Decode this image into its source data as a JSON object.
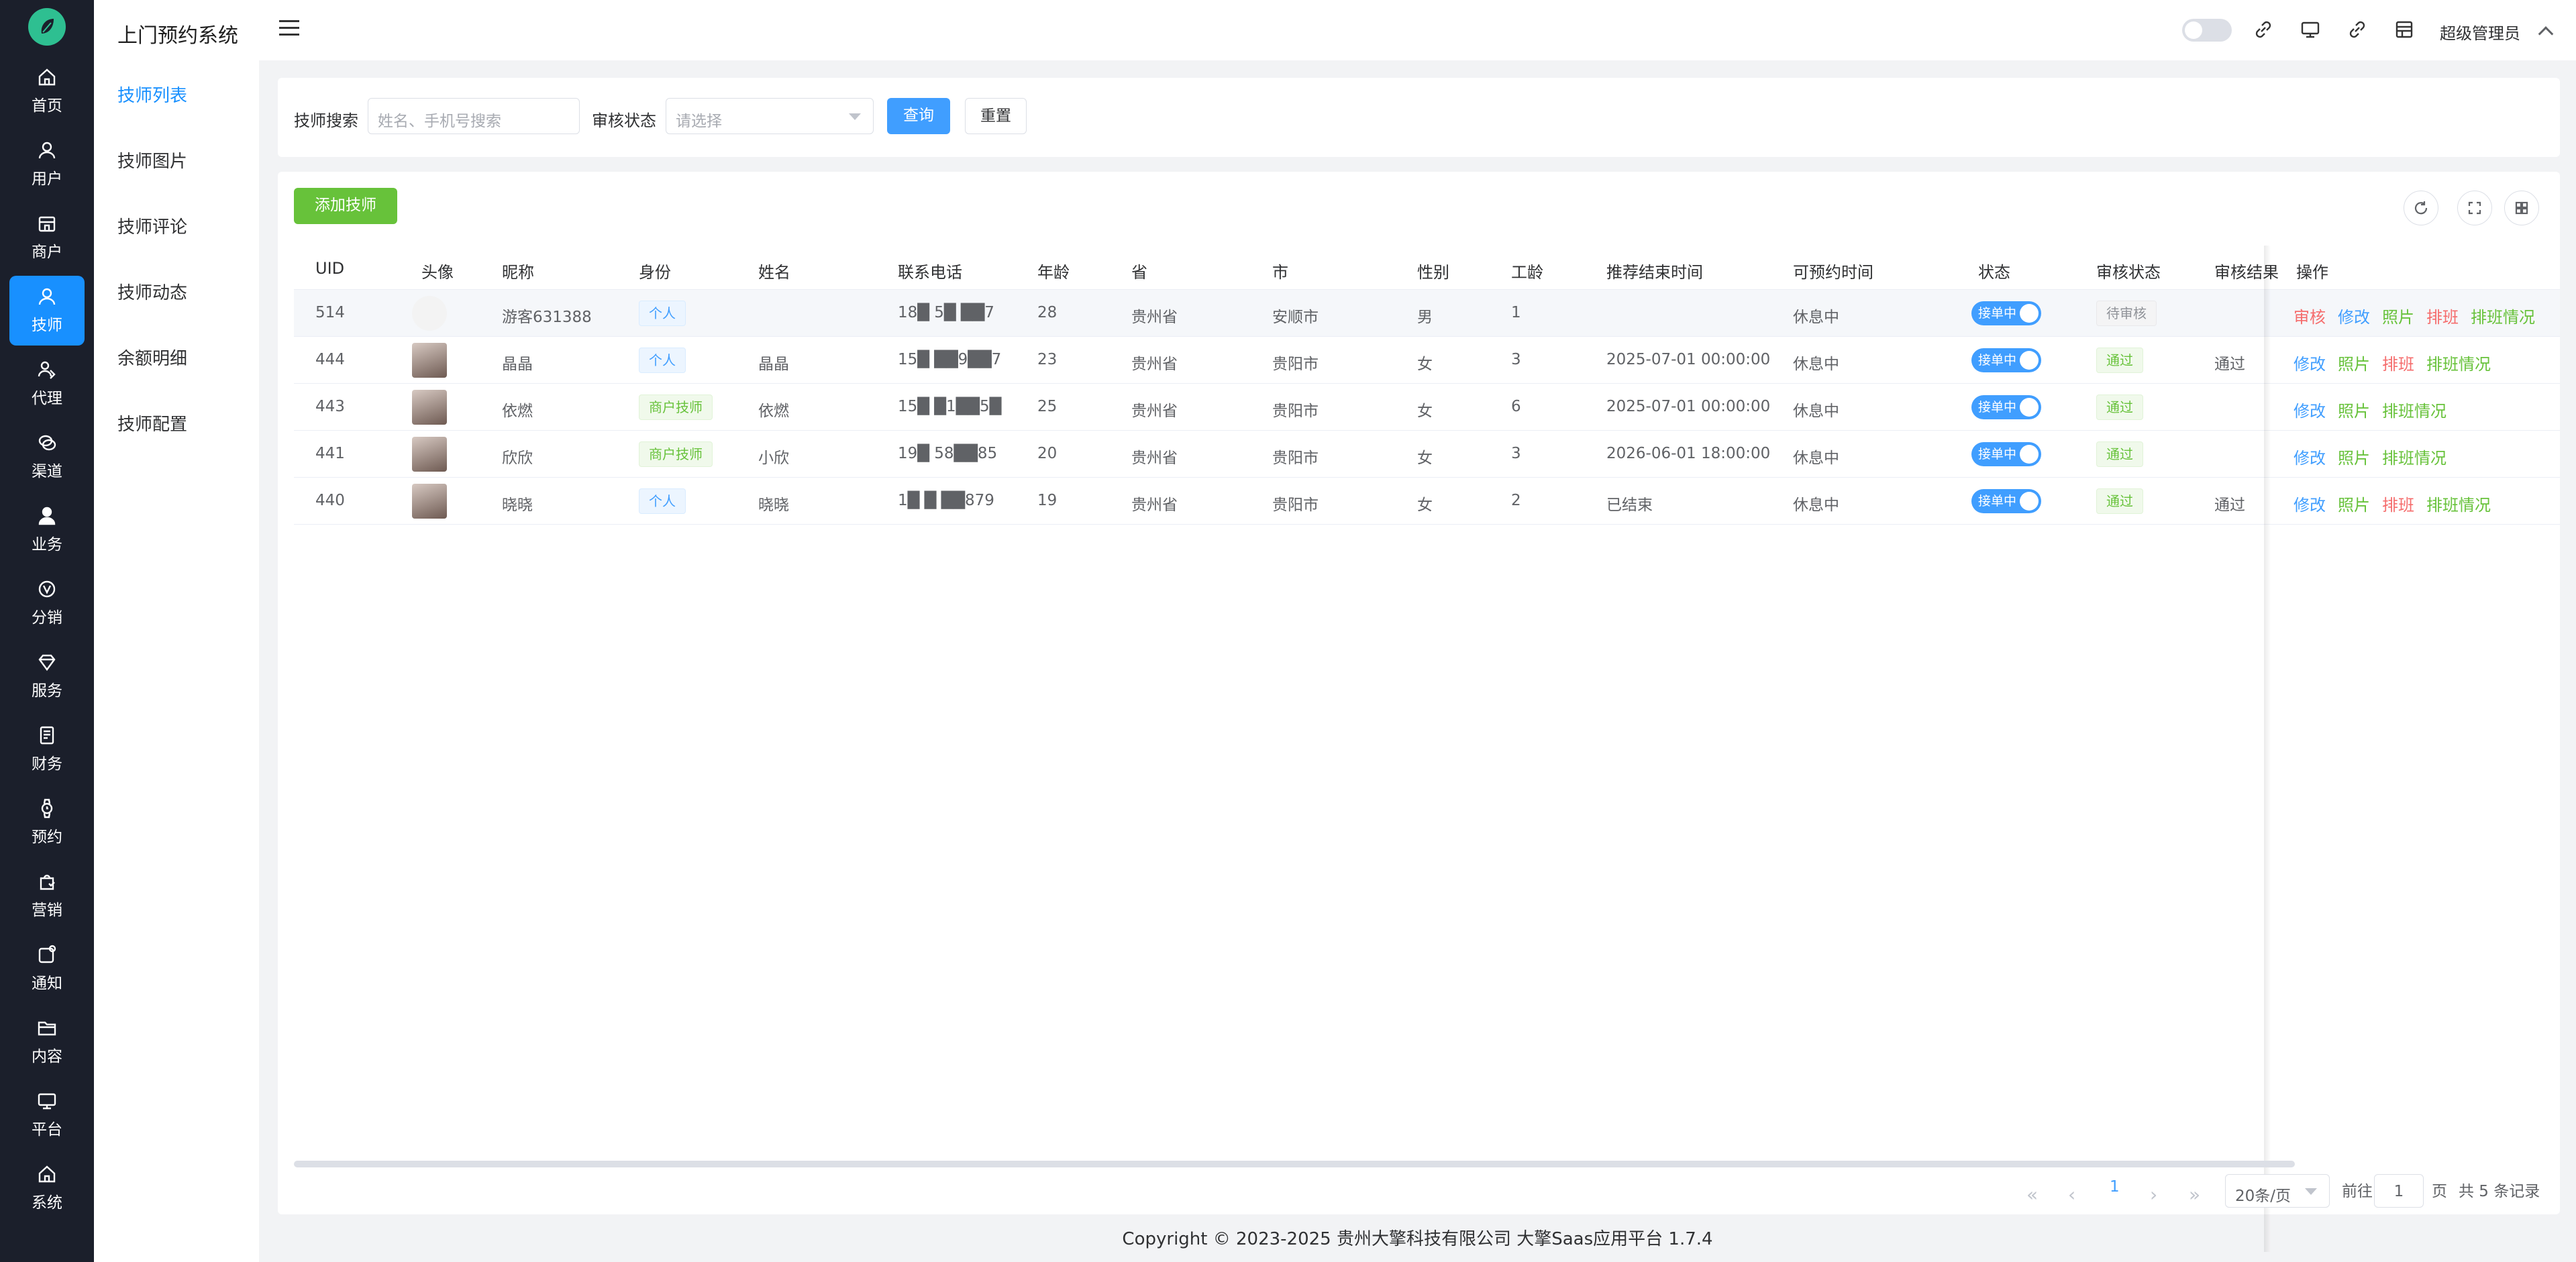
{
  "rail": {
    "items": [
      {
        "label": "首页",
        "icon": "home-icon"
      },
      {
        "label": "用户",
        "icon": "user-icon"
      },
      {
        "label": "商户",
        "icon": "store-icon"
      },
      {
        "label": "技师",
        "icon": "technician-icon"
      },
      {
        "label": "代理",
        "icon": "agent-icon"
      },
      {
        "label": "渠道",
        "icon": "channel-icon"
      },
      {
        "label": "业务",
        "icon": "business-icon"
      },
      {
        "label": "分销",
        "icon": "distribution-icon"
      },
      {
        "label": "服务",
        "icon": "diamond-icon"
      },
      {
        "label": "财务",
        "icon": "finance-icon"
      },
      {
        "label": "预约",
        "icon": "watch-icon"
      },
      {
        "label": "营销",
        "icon": "marketing-icon"
      },
      {
        "label": "通知",
        "icon": "notify-icon"
      },
      {
        "label": "内容",
        "icon": "folder-icon"
      },
      {
        "label": "平台",
        "icon": "monitor-icon"
      },
      {
        "label": "系统",
        "icon": "system-home-icon"
      }
    ],
    "active_index": 3
  },
  "submenu": {
    "title": "上门预约系统",
    "items": [
      "技师列表",
      "技师图片",
      "技师评论",
      "技师动态",
      "余额明细",
      "技师配置"
    ],
    "active_index": 0
  },
  "topbar": {
    "admin_label": "超级管理员",
    "icons": [
      "menu-icon",
      "theme-toggle",
      "link-icon",
      "monitor-icon",
      "link-icon",
      "store-icon"
    ]
  },
  "search": {
    "search_label": "技师搜索",
    "search_placeholder": "姓名、手机号搜索",
    "status_label": "审核状态",
    "status_placeholder": "请选择",
    "query_button": "查询",
    "reset_button": "重置"
  },
  "table": {
    "add_button": "添加技师",
    "columns": [
      "UID",
      "头像",
      "昵称",
      "身份",
      "姓名",
      "联系电话",
      "年龄",
      "省",
      "市",
      "性别",
      "工龄",
      "推荐结束时间",
      "可预约时间",
      "状态",
      "审核状态",
      "审核结果",
      "操作"
    ],
    "rows": [
      {
        "uid": "514",
        "avatar": "blank",
        "nickname": "游客631388",
        "identity": "个人",
        "identity_type": "blue",
        "name": "",
        "phone": "18█ 5█ ██7",
        "age": "28",
        "province": "贵州省",
        "city": "安顺市",
        "gender": "男",
        "years": "1",
        "rec_end": "",
        "available": "休息中",
        "status_switch": "接单中",
        "audit_status": "待审核",
        "audit_type": "gray",
        "audit_result": "",
        "actions": [
          {
            "label": "审核",
            "color": "red"
          },
          {
            "label": "修改",
            "color": "blue"
          },
          {
            "label": "照片",
            "color": "green"
          },
          {
            "label": "排班",
            "color": "red"
          },
          {
            "label": "排班情况",
            "color": "green"
          }
        ]
      },
      {
        "uid": "444",
        "avatar": "photo",
        "nickname": "晶晶",
        "identity": "个人",
        "identity_type": "blue",
        "name": "晶晶",
        "phone": "15█ ██9██7",
        "age": "23",
        "province": "贵州省",
        "city": "贵阳市",
        "gender": "女",
        "years": "3",
        "rec_end": "2025-07-01 00:00:00",
        "available": "休息中",
        "status_switch": "接单中",
        "audit_status": "通过",
        "audit_type": "green",
        "audit_result": "通过",
        "actions": [
          {
            "label": "修改",
            "color": "blue"
          },
          {
            "label": "照片",
            "color": "green"
          },
          {
            "label": "排班",
            "color": "red"
          },
          {
            "label": "排班情况",
            "color": "green"
          }
        ]
      },
      {
        "uid": "443",
        "avatar": "photo",
        "nickname": "依燃",
        "identity": "商户技师",
        "identity_type": "green",
        "name": "依燃",
        "phone": "15█ █1██5█",
        "age": "25",
        "province": "贵州省",
        "city": "贵阳市",
        "gender": "女",
        "years": "6",
        "rec_end": "2025-07-01 00:00:00",
        "available": "休息中",
        "status_switch": "接单中",
        "audit_status": "通过",
        "audit_type": "green",
        "audit_result": "",
        "actions": [
          {
            "label": "修改",
            "color": "blue"
          },
          {
            "label": "照片",
            "color": "green"
          },
          {
            "label": "排班情况",
            "color": "green"
          }
        ]
      },
      {
        "uid": "441",
        "avatar": "photo",
        "nickname": "欣欣",
        "identity": "商户技师",
        "identity_type": "green",
        "name": "小欣",
        "phone": "19█ 58██85",
        "age": "20",
        "province": "贵州省",
        "city": "贵阳市",
        "gender": "女",
        "years": "3",
        "rec_end": "2026-06-01 18:00:00",
        "available": "休息中",
        "status_switch": "接单中",
        "audit_status": "通过",
        "audit_type": "green",
        "audit_result": "",
        "actions": [
          {
            "label": "修改",
            "color": "blue"
          },
          {
            "label": "照片",
            "color": "green"
          },
          {
            "label": "排班情况",
            "color": "green"
          }
        ]
      },
      {
        "uid": "440",
        "avatar": "photo",
        "nickname": "晓晓",
        "identity": "个人",
        "identity_type": "blue",
        "name": "晓晓",
        "phone": "1█ █ ██879",
        "age": "19",
        "province": "贵州省",
        "city": "贵阳市",
        "gender": "女",
        "years": "2",
        "rec_end": "已结束",
        "available": "休息中",
        "status_switch": "接单中",
        "audit_status": "通过",
        "audit_type": "green",
        "audit_result": "通过",
        "actions": [
          {
            "label": "修改",
            "color": "blue"
          },
          {
            "label": "照片",
            "color": "green"
          },
          {
            "label": "排班",
            "color": "red"
          },
          {
            "label": "排班情况",
            "color": "green"
          }
        ]
      }
    ]
  },
  "pagination": {
    "current_page": "1",
    "page_size": "20条/页",
    "goto_label": "前往",
    "goto_value": "1",
    "page_unit": "页",
    "total": "共 5 条记录"
  },
  "footer": {
    "copyright": "Copyright © 2023-2025 贵州大擎科技有限公司   大擎Saas应用平台 1.7.4"
  }
}
